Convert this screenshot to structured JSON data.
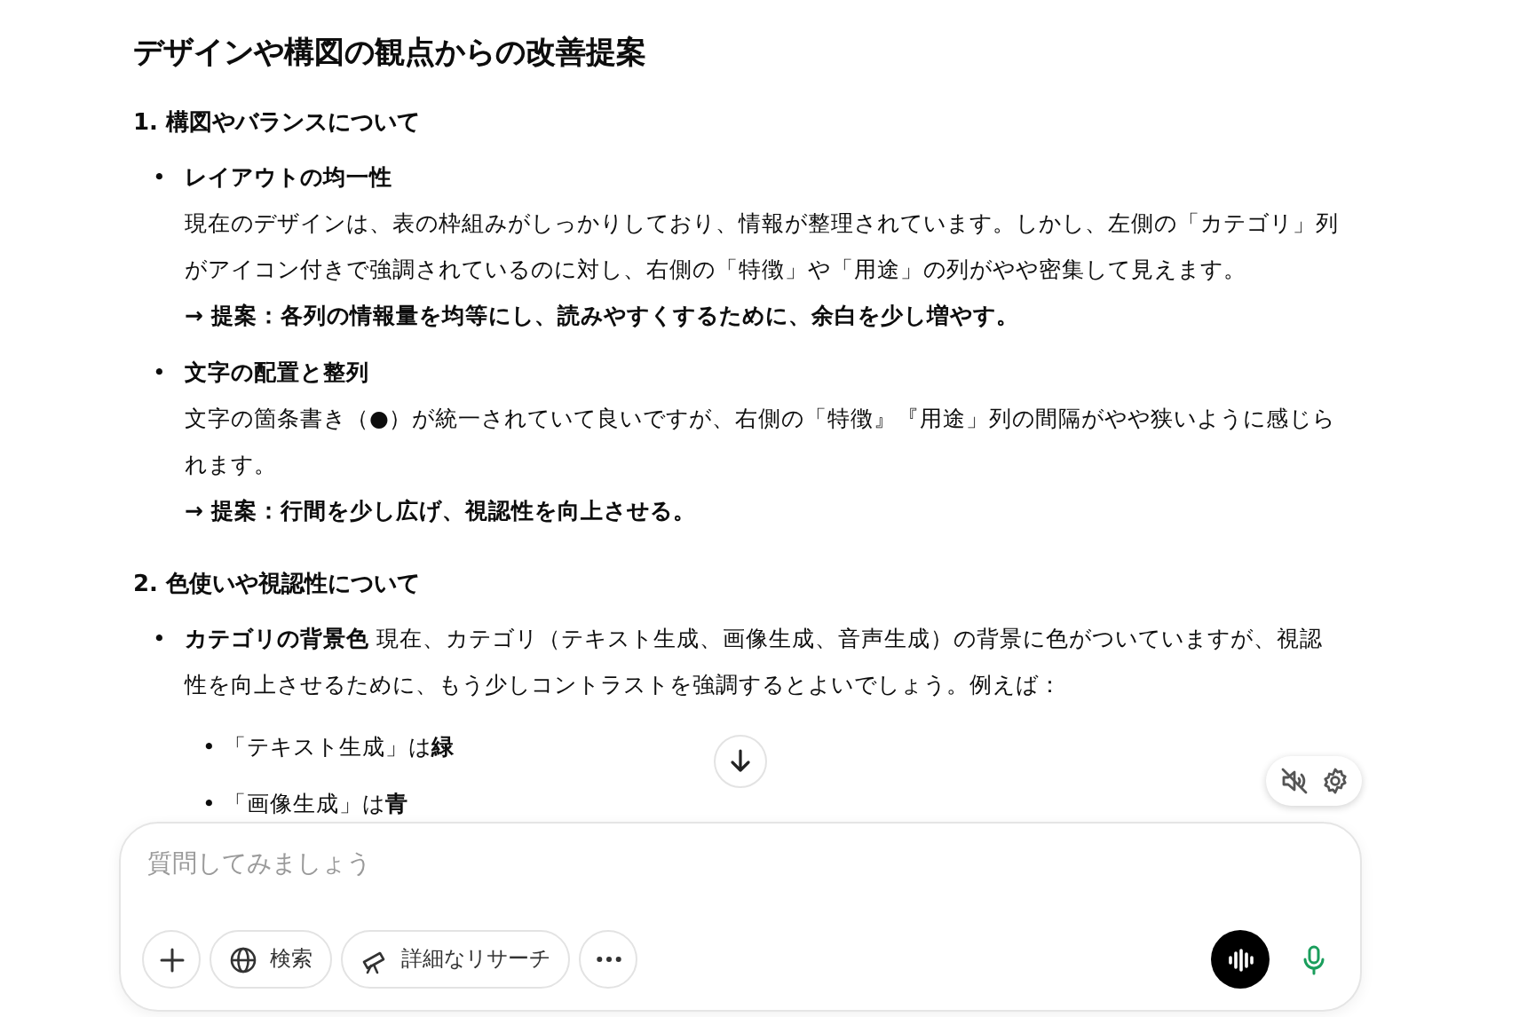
{
  "title": "デザインや構図の観点からの改善提案",
  "sections": [
    {
      "heading": "1. 構図やバランスについて",
      "items": [
        {
          "kind": "block",
          "marker": "•",
          "label": "レイアウトの均一性",
          "body": "現在のデザインは、表の枠組みがしっかりしており、情報が整理されています。しかし、左側の「カテゴリ」列がアイコン付きで強調されているのに対し、右側の「特徴」や「用途」の列がやや密集して見えます。",
          "proposal": "→ 提案：各列の情報量を均等にし、読みやすくするために、余白を少し増やす。"
        },
        {
          "kind": "block",
          "marker": "•",
          "label": "文字の配置と整列",
          "body": "文字の箇条書き（●）が統一されていて良いですが、右側の「特徴』『用途」列の間隔がやや狭いように感じられます。",
          "proposal": "→ 提案：行間を少し広げ、視認性を向上させる。"
        }
      ]
    },
    {
      "heading": "2. 色使いや視認性について",
      "items": [
        {
          "kind": "inline",
          "marker": "•",
          "label": "カテゴリの背景色",
          "body": "現在、カテゴリ（テキスト生成、画像生成、音声生成）の背景に色がついていますが、視認性を向上させるために、もう少しコントラストを強調するとよいでしょう。例えば：",
          "subitems": [
            {
              "marker": "•",
              "text": "「テキスト生成」は**緑**"
            },
            {
              "marker": "•",
              "text": "「画像生成」は**青**"
            }
          ]
        }
      ]
    }
  ],
  "composer": {
    "placeholder": "質問してみましょう",
    "tools": [
      {
        "kind": "plus"
      },
      {
        "kind": "globe",
        "label": "検索"
      },
      {
        "kind": "telescope",
        "label": "詳細なリサーチ"
      },
      {
        "kind": "more"
      }
    ]
  }
}
